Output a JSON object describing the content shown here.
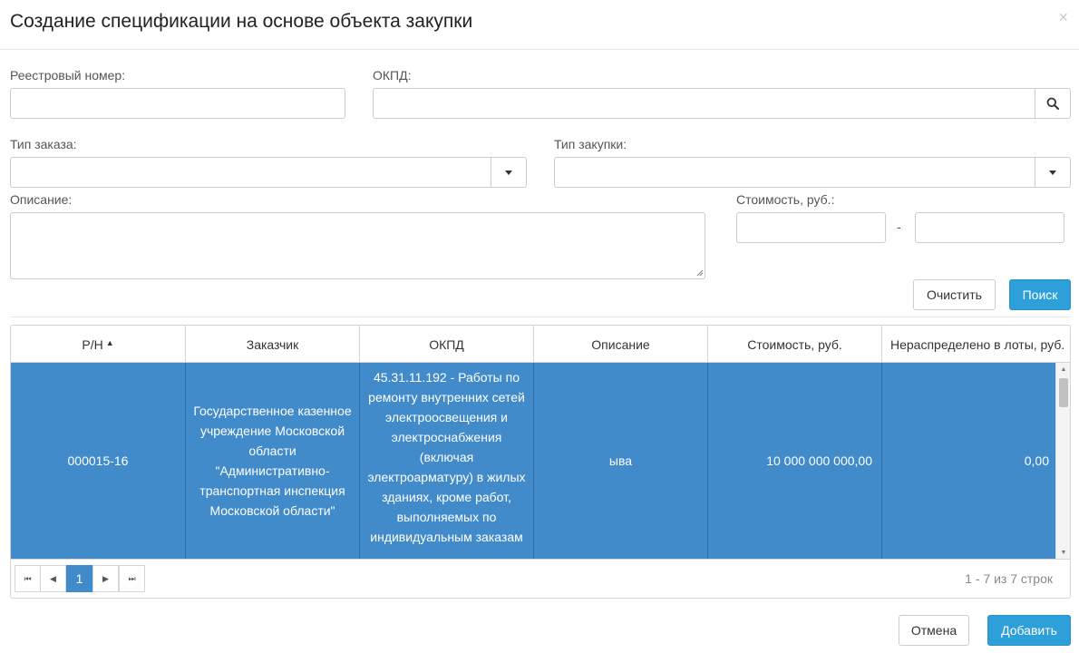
{
  "header": {
    "title": "Создание спецификации на основе объекта закупки",
    "close_symbol": "×"
  },
  "filters": {
    "registry_number": {
      "label": "Реестровый номер:",
      "value": "",
      "placeholder": ""
    },
    "okpd": {
      "label": "ОКПД:",
      "value": "",
      "placeholder": ""
    },
    "order_type": {
      "label": "Тип заказа:",
      "value": ""
    },
    "purchase_type": {
      "label": "Тип закупки:",
      "value": ""
    },
    "description": {
      "label": "Описание:",
      "value": ""
    },
    "cost": {
      "label": "Стоимость, руб.:",
      "from": "",
      "to": "",
      "separator": "-"
    },
    "clear_label": "Очистить",
    "search_label": "Поиск"
  },
  "grid": {
    "columns": [
      "Р/Н",
      "Заказчик",
      "ОКПД",
      "Описание",
      "Стоимость, руб.",
      "Нераспределено в лоты, руб."
    ],
    "sort_indicator": "▲",
    "rows": [
      {
        "reg_number": "000015-16",
        "customer": "Государственное казенное учреждение Московской области \"Административно-транспортная инспекция Московской области\"",
        "okpd": "45.31.11.192 - Работы по ремонту внутренних сетей электроосвещения и электроснабжения (включая электроарматуру) в жилых зданиях, кроме работ, выполняемых по индивидуальным заказам",
        "description": "ыва",
        "cost": "10 000 000 000,00",
        "unallocated": "0,00"
      }
    ],
    "pager": {
      "first": "⏮",
      "prev": "◀",
      "current_page": "1",
      "next": "▶",
      "last": "⏭",
      "info": "1 - 7 из 7 строк"
    }
  },
  "footer": {
    "cancel_label": "Отмена",
    "add_label": "Добавить"
  },
  "colors": {
    "selected_row": "#428bca",
    "primary": "#2d9fd9"
  }
}
